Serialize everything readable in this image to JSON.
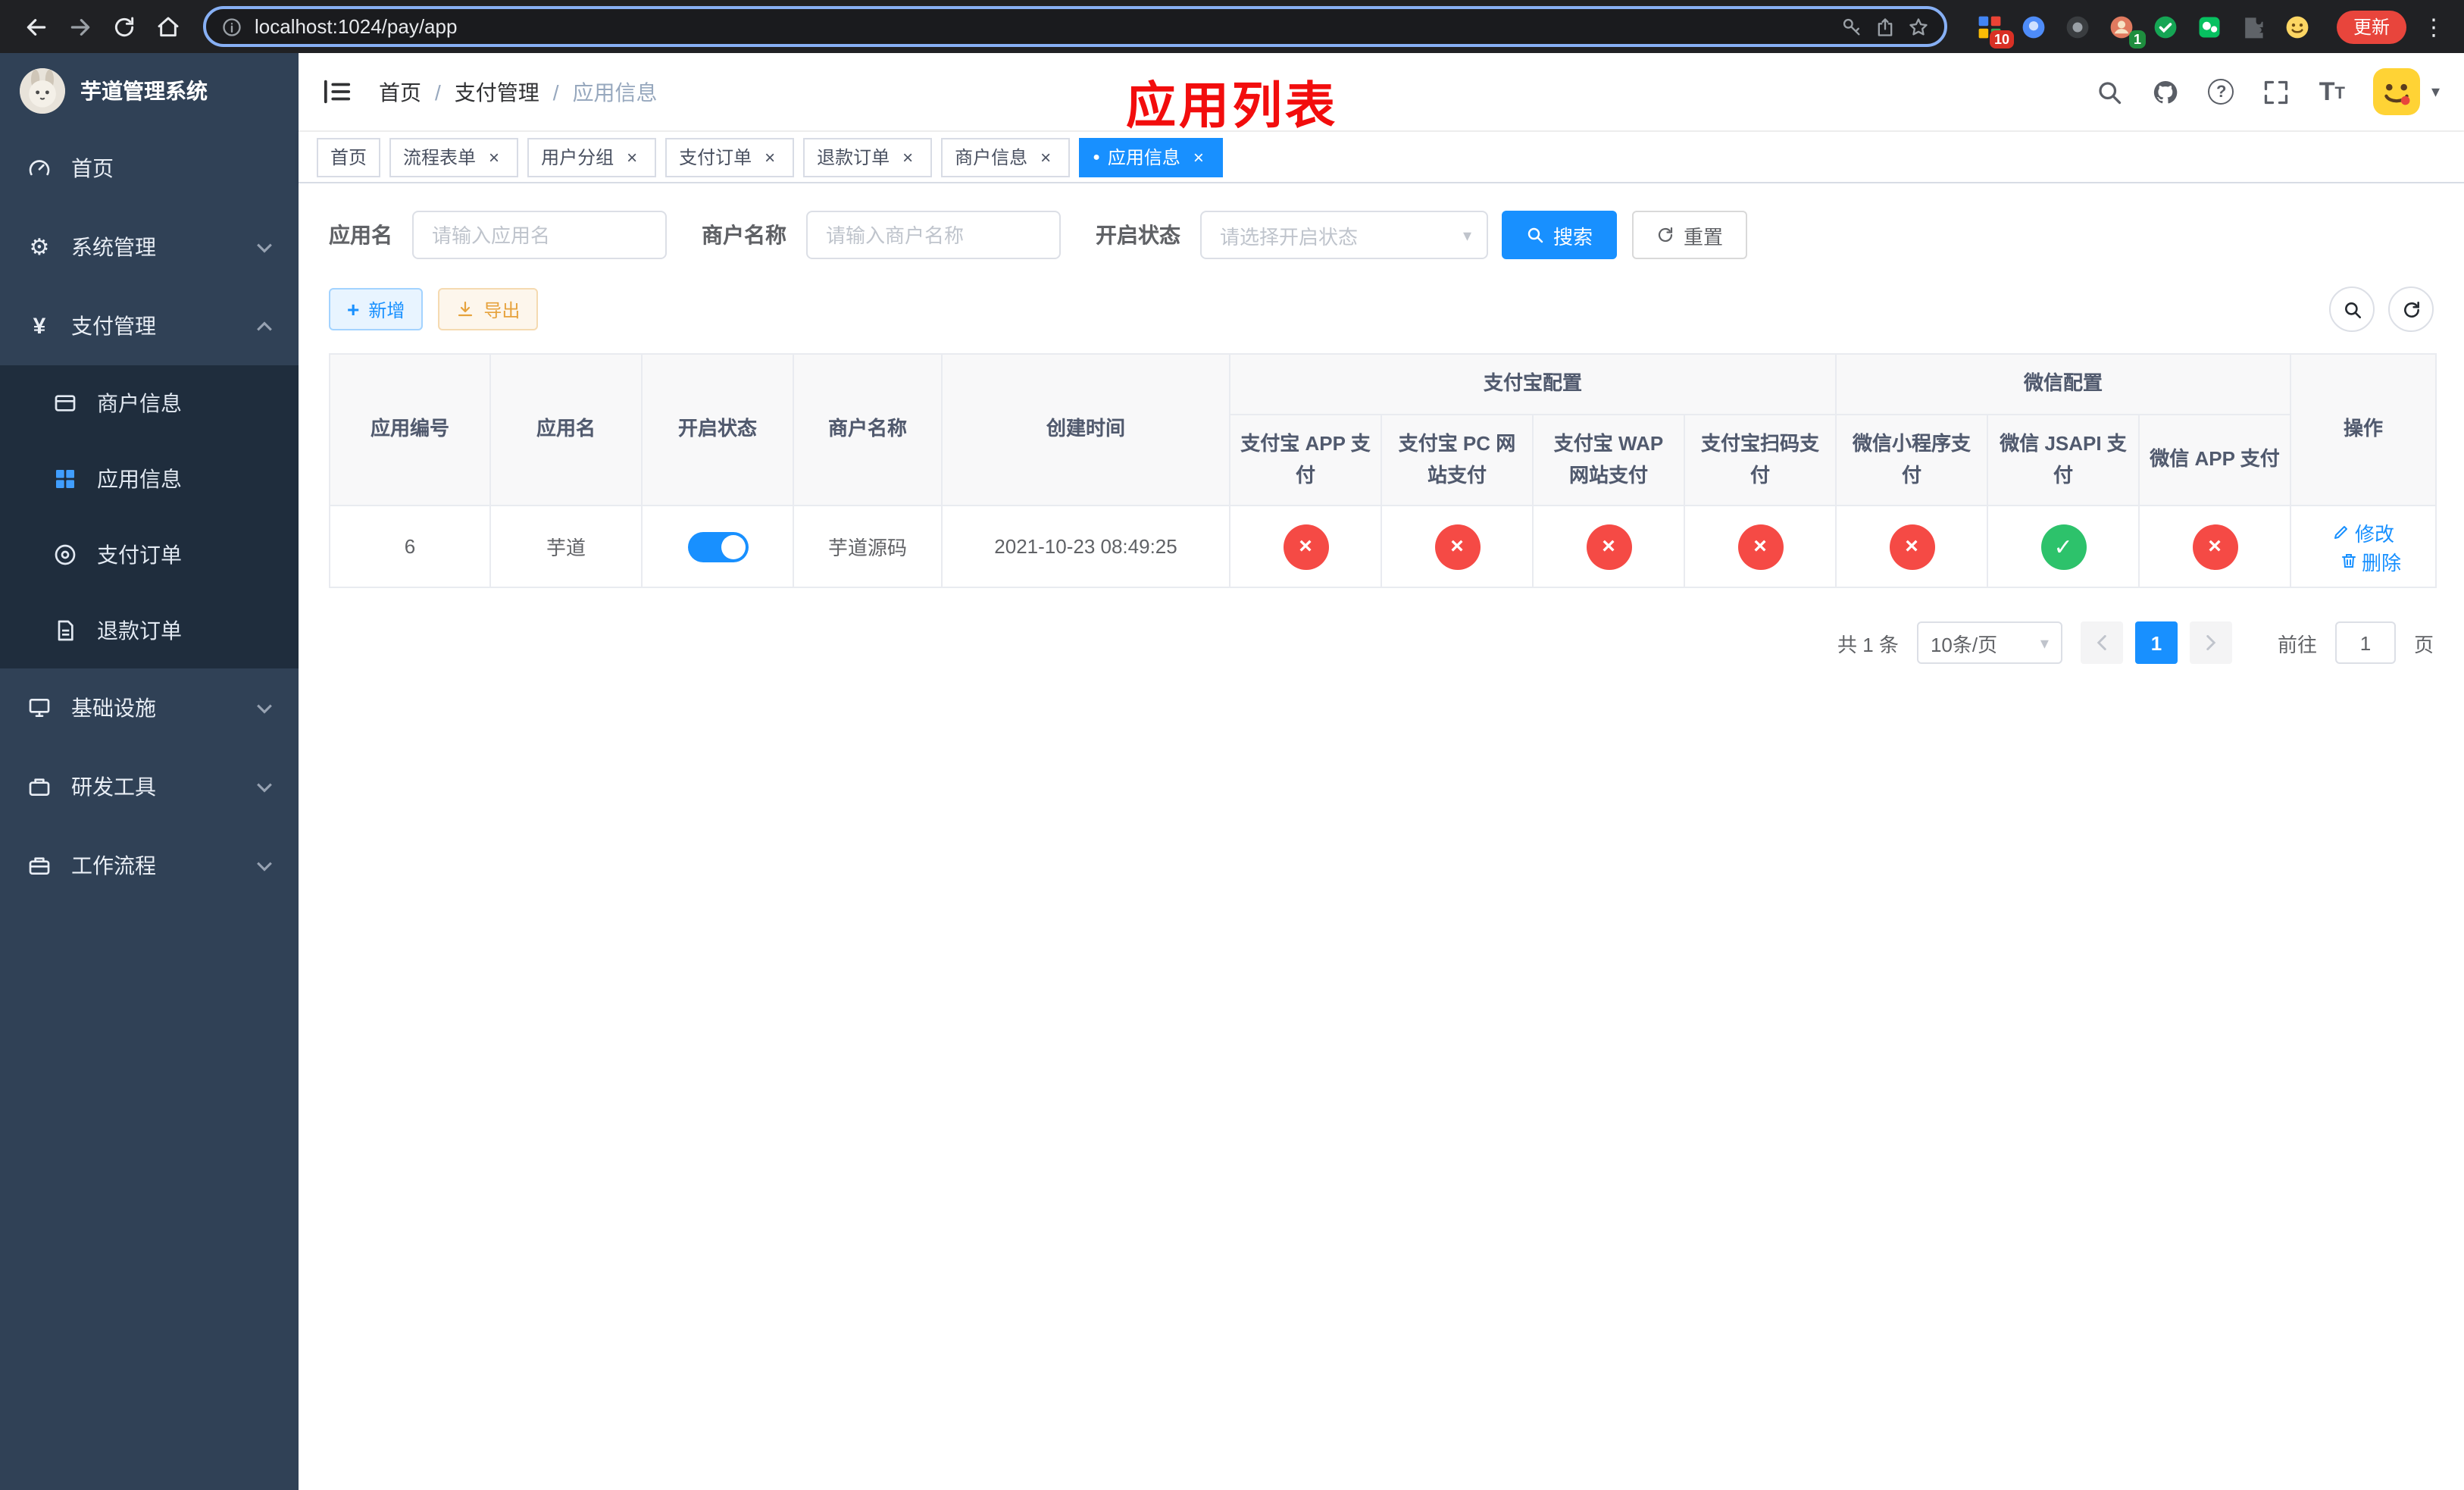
{
  "colors": {
    "primary": "#1890ff",
    "danger": "#f54a45",
    "success": "#2dc26b",
    "annotation": "#f20d0d",
    "sidebar": "#304156",
    "submenu": "#1f2d3d"
  },
  "icons": {
    "close": "×",
    "cross": "×",
    "check": "✓",
    "dot": "●",
    "caret_down": "▾",
    "gear": "⚙",
    "yen": "¥",
    "question": "?",
    "plus": "+",
    "kebab": "⋮",
    "font_size": "T"
  },
  "browser": {
    "url": "localhost:1024/pay/app",
    "update_label": "更新",
    "extension_badges": {
      "first": "10",
      "second": "1"
    }
  },
  "sidebar": {
    "app_title": "芋道管理系统",
    "menu": [
      {
        "label": "首页"
      },
      {
        "label": "系统管理"
      },
      {
        "label": "支付管理",
        "children": [
          {
            "label": "商户信息"
          },
          {
            "label": "应用信息",
            "active": true
          },
          {
            "label": "支付订单"
          },
          {
            "label": "退款订单"
          }
        ]
      },
      {
        "label": "基础设施"
      },
      {
        "label": "研发工具"
      },
      {
        "label": "工作流程"
      }
    ]
  },
  "header": {
    "breadcrumb": {
      "home": "首页",
      "sep": "/",
      "section": "支付管理",
      "current": "应用信息"
    },
    "annotation": "应用列表"
  },
  "tabs": [
    {
      "label": "首页",
      "closable": false
    },
    {
      "label": "流程表单",
      "closable": true
    },
    {
      "label": "用户分组",
      "closable": true
    },
    {
      "label": "支付订单",
      "closable": true
    },
    {
      "label": "退款订单",
      "closable": true
    },
    {
      "label": "商户信息",
      "closable": true
    },
    {
      "label": "应用信息",
      "closable": true,
      "active": true
    }
  ],
  "filters": {
    "app_name": {
      "label": "应用名",
      "placeholder": "请输入应用名",
      "value": ""
    },
    "merchant_name": {
      "label": "商户名称",
      "placeholder": "请输入商户名称",
      "value": ""
    },
    "status": {
      "label": "开启状态",
      "placeholder": "请选择开启状态"
    },
    "search_label": "搜索",
    "reset_label": "重置"
  },
  "toolbar": {
    "add_label": "新增",
    "export_label": "导出"
  },
  "table": {
    "groups": {
      "alipay": "支付宝配置",
      "wechat": "微信配置",
      "actions": "操作"
    },
    "columns": {
      "id": "应用编号",
      "name": "应用名",
      "status": "开启状态",
      "merchant": "商户名称",
      "created": "创建时间",
      "alipay_app": "支付宝 APP 支付",
      "alipay_pc": "支付宝 PC 网站支付",
      "alipay_wap": "支付宝 WAP 网站支付",
      "alipay_qr": "支付宝扫码支付",
      "wechat_mini": "微信小程序支付",
      "wechat_jsapi": "微信 JSAPI 支付",
      "wechat_app": "微信 APP 支付"
    },
    "rows": [
      {
        "id": "6",
        "name": "芋道",
        "enabled": true,
        "merchant": "芋道源码",
        "created_at": "2021-10-23 08:49:25",
        "config": {
          "alipay_app": false,
          "alipay_pc": false,
          "alipay_wap": false,
          "alipay_qr": false,
          "wechat_mini": false,
          "wechat_jsapi": true,
          "wechat_app": false
        },
        "actions": {
          "edit": "修改",
          "delete": "删除"
        }
      }
    ]
  },
  "pagination": {
    "total": "共 1 条",
    "page_size": "10条/页",
    "page": "1",
    "goto_label": "前往",
    "goto_value": "1",
    "unit_label": "页"
  }
}
